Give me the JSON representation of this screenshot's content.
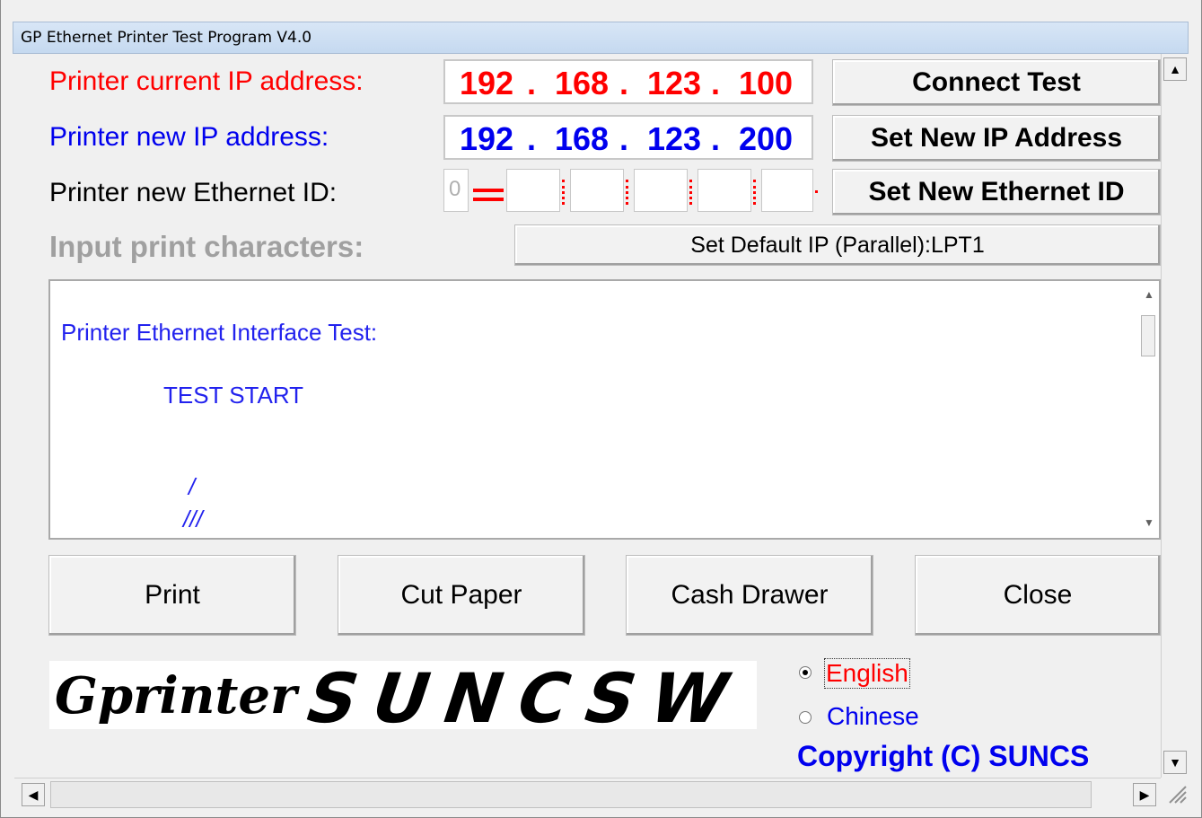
{
  "window": {
    "title": "GP Ethernet Printer Test Program  V4.0"
  },
  "labels": {
    "current_ip": "Printer current IP address:",
    "new_ip": "Printer new IP address:",
    "ethernet_id": "Printer new Ethernet ID:",
    "input_chars": "Input print characters:"
  },
  "current_ip": [
    "192",
    "168",
    "123",
    "100"
  ],
  "new_ip": [
    "192",
    "168",
    "123",
    "200"
  ],
  "ethernet_id": {
    "first": "0",
    "fields": [
      "",
      "",
      "",
      "",
      ""
    ]
  },
  "buttons": {
    "connect_test": "Connect Test",
    "set_new_ip": "Set New IP Address",
    "set_new_ethernet_id": "Set New Ethernet ID",
    "set_default_ip": "Set Default IP (Parallel):LPT1",
    "print": "Print",
    "cut_paper": "Cut Paper",
    "cash_drawer": "Cash Drawer",
    "close": "Close"
  },
  "print_text": {
    "line1": "Printer Ethernet Interface Test:",
    "line2": "TEST  START",
    "line3": "/",
    "line4": "///"
  },
  "language": {
    "english": "English",
    "chinese": "Chinese",
    "selected": "English"
  },
  "logo_text": "GprinterSUNCSW",
  "copyright": "Copyright (C) SUNCS",
  "colors": {
    "red": "#ff0000",
    "blue": "#0000ee",
    "gray_label": "#a0a0a0",
    "title_bar": "#c5d9f0"
  }
}
